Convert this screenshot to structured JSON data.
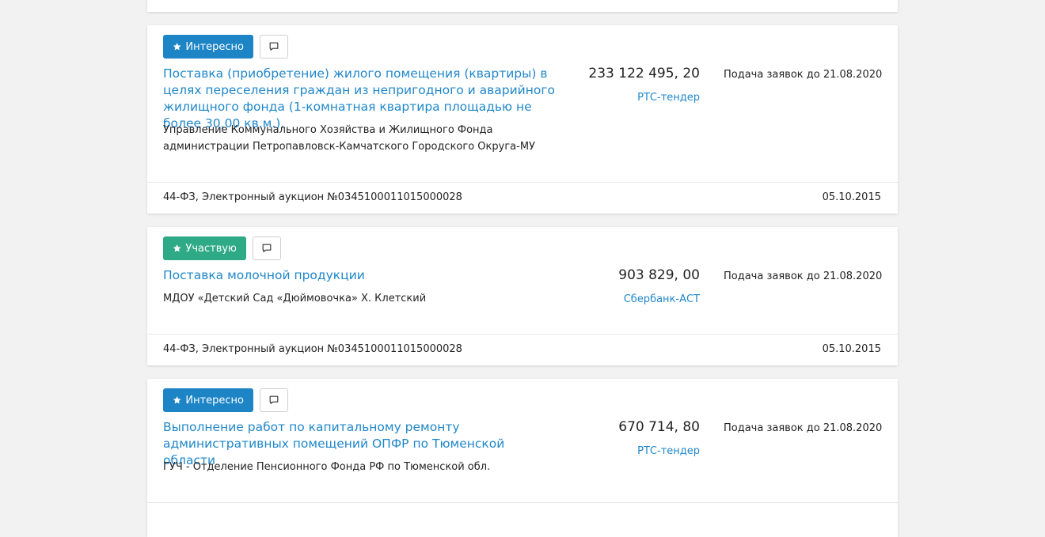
{
  "cards": [
    {
      "tag": {
        "label": "Интересно",
        "style": "blue"
      },
      "title": "Поставка (приобретение) жилого помещения (квартиры) в целях переселения граждан из непригодного и аварийного жилищного фонда (1-комнатная квартира площадью не более 30,00 кв.м.).",
      "customer": "Управление Коммунального Хозяйства и Жилищного Фонда администрации Петропавловск-Камчатского Городского Округа-МУ",
      "price": "233 122 495, 20",
      "platform": "РТС-тендер",
      "deadline": "Подача заявок до 21.08.2020",
      "footer_left": "44-ФЗ, Электронный аукцион №0345100011015000028",
      "footer_right": "05.10.2015"
    },
    {
      "tag": {
        "label": "Участвую",
        "style": "green"
      },
      "title": "Поставка молочной продукции",
      "customer": "МДОУ «Детский Сад «Дюймовочка» Х. Клетский",
      "price": "903 829, 00",
      "platform": "Сбербанк-АСТ",
      "deadline": "Подача заявок до 21.08.2020",
      "footer_left": "44-ФЗ, Электронный аукцион №0345100011015000028",
      "footer_right": "05.10.2015"
    },
    {
      "tag": {
        "label": "Интересно",
        "style": "blue"
      },
      "title": "Выполнение работ по капитальному ремонту административных помещений ОПФР по Тюменской области",
      "customer": "ГУЧ - Отделение Пенсионного Фонда РФ по Тюменской обл.",
      "price": "670 714, 80",
      "platform": "РТС-тендер",
      "deadline": "Подача заявок до 21.08.2020"
    }
  ],
  "colors": {
    "tag_blue": "#1d84c6",
    "tag_green": "#2eaa86",
    "link": "#1f87c9",
    "background": "#f2f2f2"
  },
  "icons": {
    "tag_icon": "star-icon",
    "comment_icon": "comment-icon"
  }
}
